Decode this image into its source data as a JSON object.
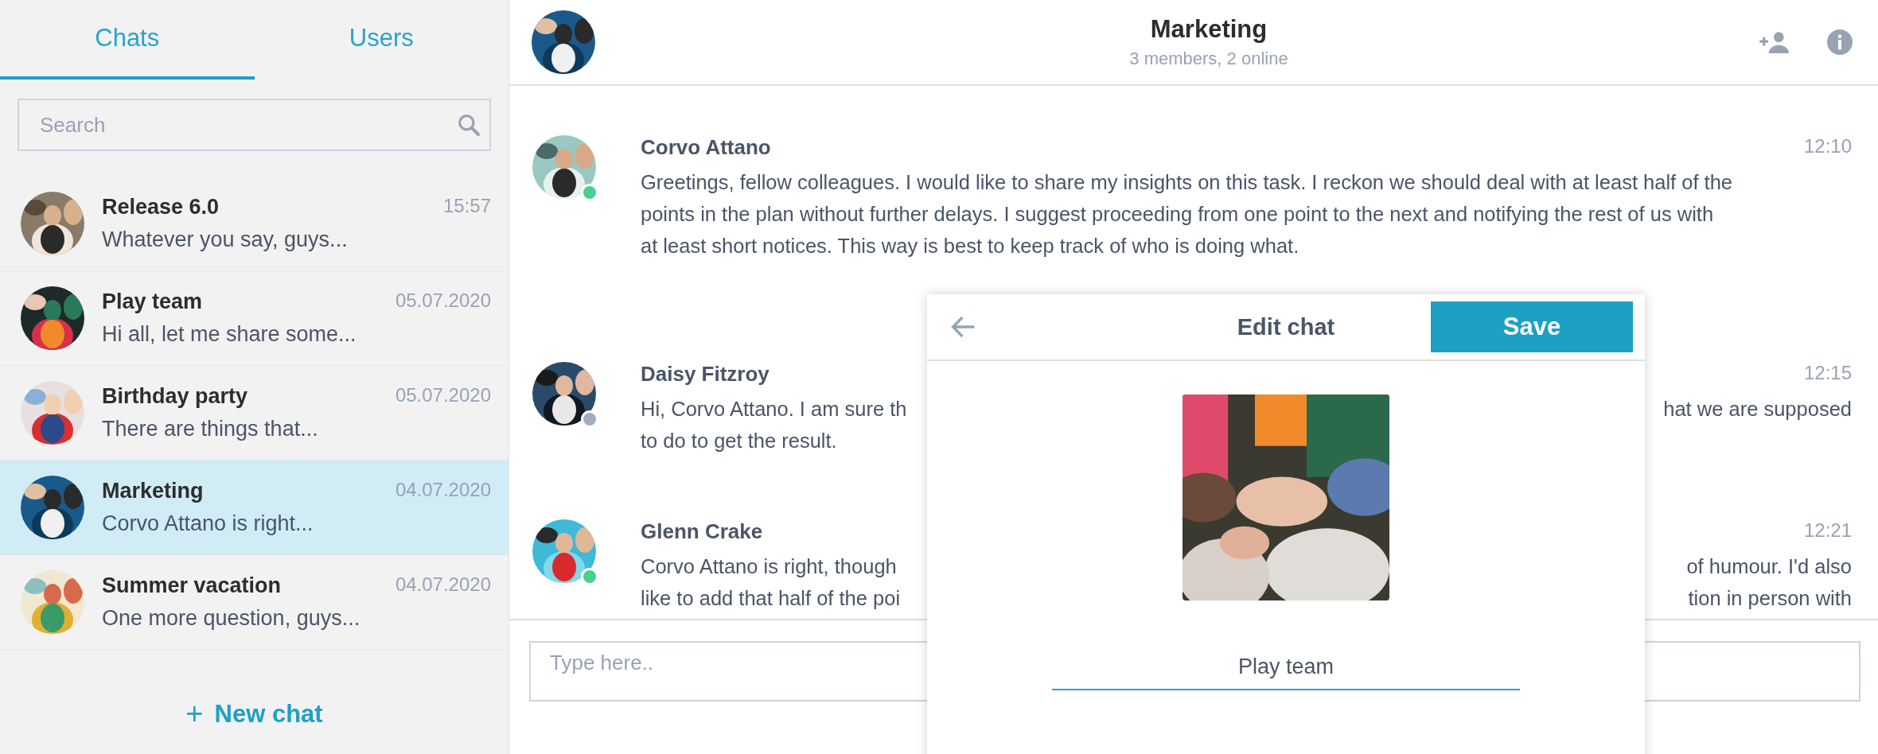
{
  "tabs": [
    {
      "label": "Chats",
      "selected": true
    },
    {
      "label": "Users",
      "selected": false
    }
  ],
  "search": {
    "placeholder": "Search"
  },
  "chats": [
    {
      "name": "Release 6.0",
      "time": "15:57",
      "preview": "Whatever you say, guys...",
      "selected": false
    },
    {
      "name": "Play team",
      "time": "05.07.2020",
      "preview": "Hi all, let me share some...",
      "selected": false
    },
    {
      "name": "Birthday party",
      "time": "05.07.2020",
      "preview": "There are things that...",
      "selected": false
    },
    {
      "name": "Marketing",
      "time": "04.07.2020",
      "preview": "Corvo Attano is right...",
      "selected": true
    },
    {
      "name": "Summer vacation",
      "time": "04.07.2020",
      "preview": "One more question, guys...",
      "selected": false
    }
  ],
  "new_chat": {
    "icon": "+",
    "label": "New chat"
  },
  "header": {
    "title": "Marketing",
    "subtitle": "3 members, 2 online"
  },
  "messages": [
    {
      "author": "Corvo Attano",
      "time": "12:10",
      "online": true,
      "lines": [
        {
          "left": "Greetings, fellow colleagues. I would like to share my insights on this task. I reckon we should deal with at least half of the"
        },
        {
          "left": "points in the plan without further delays. I suggest proceeding from one point to the next and notifying the rest of us with"
        },
        {
          "left": "at least short notices. This way is best to keep track of who is doing what."
        }
      ]
    },
    {
      "author": "Daisy Fitzroy",
      "time": "12:15",
      "online": false,
      "lines": [
        {
          "left": "Hi, Corvo Attano. I am sure th",
          "right": "hat we are supposed"
        },
        {
          "left": "to do to get the result."
        }
      ]
    },
    {
      "author": "Glenn Crake",
      "time": "12:21",
      "online": true,
      "lines": [
        {
          "left": "Corvo Attano is right, though",
          "right": "of humour. I'd also"
        },
        {
          "left": "like to add that half of the poi",
          "right": "tion in person with"
        }
      ]
    }
  ],
  "composer": {
    "placeholder": "Type here.."
  },
  "dialog": {
    "title": "Edit chat",
    "save": "Save",
    "name_value": "Play team"
  }
}
